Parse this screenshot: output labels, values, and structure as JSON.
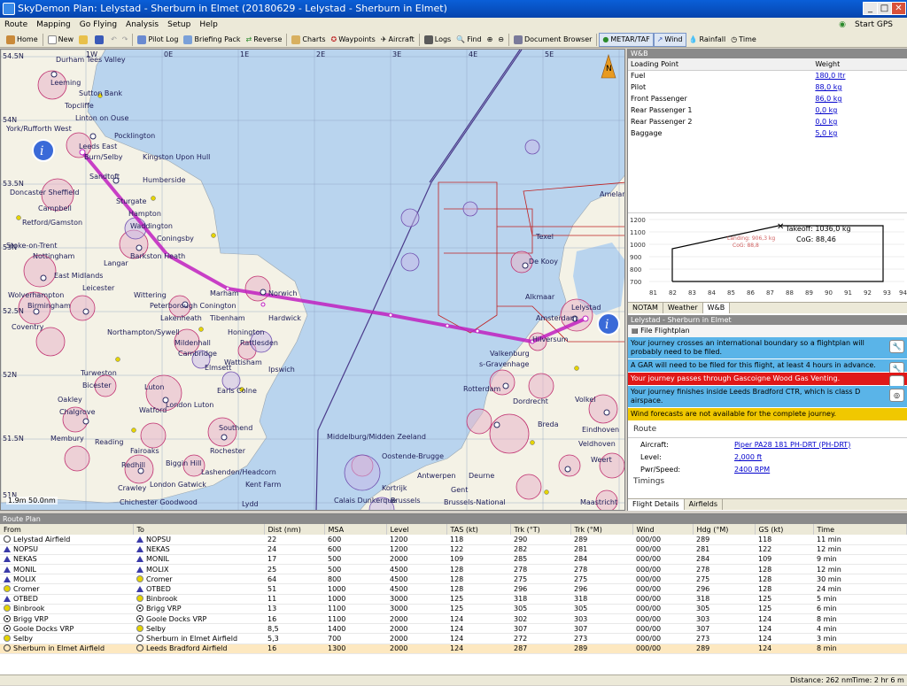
{
  "window": {
    "title": "SkyDemon Plan: Lelystad - Sherburn in Elmet (20180629 - Lelystad - Sherburn in Elmet)",
    "min": "_",
    "max": "□",
    "close": "✕"
  },
  "menu": {
    "items": [
      "Route",
      "Mapping",
      "Go Flying",
      "Analysis",
      "Setup",
      "Help"
    ],
    "start_gps": "Start GPS"
  },
  "toolbar": {
    "home": "Home",
    "new": "New",
    "pilot_log": "Pilot Log",
    "briefing": "Briefing Pack",
    "reverse": "Reverse",
    "charts": "Charts",
    "waypoints": "Waypoints",
    "aircraft": "Aircraft",
    "logs": "Logs",
    "find": "Find",
    "doc_browser": "Document Browser",
    "metar": "METAR/TAF",
    "wind": "Wind",
    "rainfall": "Rainfall",
    "time": "Time"
  },
  "map": {
    "lon_labels": [
      "1W",
      "0E",
      "1E",
      "2E",
      "3E",
      "4E",
      "5E"
    ],
    "lat_labels": [
      "54.5N",
      "54N",
      "53.5N",
      "53N",
      "52.5N",
      "52N",
      "51.5N",
      "51N"
    ],
    "north": "N",
    "places": [
      "Durham Tees Valley",
      "Leeming",
      "Sutton Bank",
      "Topcliffe",
      "Linton on Ouse",
      "York/Rufforth West",
      "Pocklington",
      "Leeds East",
      "Burn/Selby",
      "Kingston Upon Hull",
      "Humberside",
      "Sandtoft",
      "Doncaster Sheffield",
      "Sturgate",
      "Campbell",
      "Retford/Gamston",
      "Hampton",
      "Waddington",
      "Coningsby",
      "Barkston Heath",
      "Stoke-on-Trent",
      "Nottingham",
      "Langar",
      "East Midlands",
      "Leicester",
      "Marham",
      "Norwich",
      "Wolverhampton",
      "Birmingham",
      "Wittering",
      "Peterborough Conington",
      "Lakenheath",
      "Tibenham",
      "Hardwick",
      "Coventry",
      "Northampton/Sywell",
      "Honington",
      "Mildenhall",
      "Rattlesden",
      "Wattisham",
      "Ipswich",
      "Cambridge",
      "Elmsett",
      "Earls Colne",
      "Turweston",
      "Bicester",
      "Oakley",
      "Luton",
      "London Luton",
      "Chalgrove",
      "Watford",
      "Southend",
      "Membury",
      "Reading",
      "Fairoaks",
      "Biggin Hill",
      "Rochester",
      "Redhill",
      "London Gatwick",
      "Lashenden/Headcorn",
      "Kent Farm",
      "Lydd",
      "Crawley",
      "Chichester Goodwood",
      "Texel",
      "De Kooy",
      "Alkmaar",
      "Amsterdam",
      "Lelystad",
      "Hilversum",
      "Valkenburg",
      "s-Gravenhage",
      "Rotterdam",
      "Dordrecht",
      "Eindhoven",
      "Breda",
      "Middelburg/Midden Zeeland",
      "Oostende-Brugge",
      "Antwerpen",
      "Deurne",
      "Kortrijk",
      "Gent",
      "Calais Dunkerque",
      "Brussels",
      "Brussels-National",
      "Maastricht",
      "Volkel",
      "Veldhoven",
      "Weert",
      "Ameland"
    ],
    "scale": "1.9m 50.0nm"
  },
  "wb": {
    "header": "W&B",
    "col_item": "Loading Point",
    "col_weight": "Weight",
    "rows": [
      {
        "item": "Fuel",
        "weight": "180,0 ltr"
      },
      {
        "item": "Pilot",
        "weight": "88,0 kg"
      },
      {
        "item": "Front Passenger",
        "weight": "86,0 kg"
      },
      {
        "item": "Rear Passenger 1",
        "weight": "0,0 kg"
      },
      {
        "item": "Rear Passenger 2",
        "weight": "0,0 kg"
      },
      {
        "item": "Baggage",
        "weight": "5,0 kg"
      }
    ],
    "cog_chart": {
      "y_ticks": [
        "1200",
        "1100",
        "1000",
        "900",
        "800",
        "700"
      ],
      "x_ticks": [
        "81",
        "82",
        "83",
        "84",
        "85",
        "86",
        "87",
        "88",
        "89",
        "90",
        "91",
        "92",
        "93",
        "94"
      ],
      "takeoff": "Takeoff: 1036,0 kg",
      "cog": "CoG: 88,46",
      "landing": "Landing: 906,3 kg",
      "landing_cog": "CoG: 88,8"
    },
    "tabs": [
      "NOTAM",
      "Weather",
      "W&B"
    ]
  },
  "flight": {
    "header": "Lelystad - Sherburn in Elmet",
    "file_label": "File Flightplan",
    "messages": [
      {
        "text": "Your journey crosses an international boundary so a flightplan will probably need to be filed.",
        "color": "#5ab4e8",
        "icon": "wrench"
      },
      {
        "text": "A GAR will need to be filed for this flight, at least 4 hours in advance.",
        "color": "#5ab4e8",
        "icon": "wrench"
      },
      {
        "text": "Your journey passes through Gascoigne Wood Gas Venting.",
        "color": "#e01818",
        "icon": "binoculars"
      },
      {
        "text": "Your journey finishes inside Leeds Bradford CTR, which is class D airspace.",
        "color": "#5ab4e8",
        "icon": "binoculars"
      },
      {
        "text": "Wind forecasts are not available for the complete journey.",
        "color": "#f0c800",
        "icon": ""
      }
    ],
    "route_title": "Route",
    "aircraft_label": "Aircraft:",
    "aircraft_value": "Piper PA28 181 PH-DRT (PH-DRT)",
    "level_label": "Level:",
    "level_value": "2,000 ft",
    "pwr_label": "Pwr/Speed:",
    "pwr_value": "2400 RPM",
    "timings": "Timings",
    "tabs": [
      "Flight Details",
      "Airfields"
    ]
  },
  "route_plan": {
    "title": "Route Plan",
    "columns": [
      "From",
      "To",
      "Dist (nm)",
      "MSA",
      "Level",
      "TAS (kt)",
      "Trk (°T)",
      "Trk (°M)",
      "Wind",
      "Hdg (°M)",
      "GS (kt)",
      "Time"
    ],
    "rows": [
      {
        "from": "Lelystad Airfield",
        "from_icon": "air",
        "to": "NOPSU",
        "to_icon": "tri",
        "dist": "22",
        "msa": "600",
        "level": "1200",
        "tas": "118",
        "trkt": "290",
        "trkm": "289",
        "wind": "000/00",
        "hdg": "289",
        "gs": "118",
        "time": "11 min"
      },
      {
        "from": "NOPSU",
        "from_icon": "tri",
        "to": "NEKAS",
        "to_icon": "tri",
        "dist": "24",
        "msa": "600",
        "level": "1200",
        "tas": "122",
        "trkt": "282",
        "trkm": "281",
        "wind": "000/00",
        "hdg": "281",
        "gs": "122",
        "time": "12 min"
      },
      {
        "from": "NEKAS",
        "from_icon": "tri",
        "to": "MONIL",
        "to_icon": "tri",
        "dist": "17",
        "msa": "500",
        "level": "2000",
        "tas": "109",
        "trkt": "285",
        "trkm": "284",
        "wind": "000/00",
        "hdg": "284",
        "gs": "109",
        "time": "9 min"
      },
      {
        "from": "MONIL",
        "from_icon": "tri",
        "to": "MOLIX",
        "to_icon": "tri",
        "dist": "25",
        "msa": "500",
        "level": "4500",
        "tas": "128",
        "trkt": "278",
        "trkm": "278",
        "wind": "000/00",
        "hdg": "278",
        "gs": "128",
        "time": "12 min"
      },
      {
        "from": "MOLIX",
        "from_icon": "tri",
        "to": "Cromer",
        "to_icon": "dot",
        "dist": "64",
        "msa": "800",
        "level": "4500",
        "tas": "128",
        "trkt": "275",
        "trkm": "275",
        "wind": "000/00",
        "hdg": "275",
        "gs": "128",
        "time": "30 min"
      },
      {
        "from": "Cromer",
        "from_icon": "dot",
        "to": "OTBED",
        "to_icon": "tri",
        "dist": "51",
        "msa": "1000",
        "level": "4500",
        "tas": "128",
        "trkt": "296",
        "trkm": "296",
        "wind": "000/00",
        "hdg": "296",
        "gs": "128",
        "time": "24 min"
      },
      {
        "from": "OTBED",
        "from_icon": "tri",
        "to": "Binbrook",
        "to_icon": "dot",
        "dist": "11",
        "msa": "1000",
        "level": "3000",
        "tas": "125",
        "trkt": "318",
        "trkm": "318",
        "wind": "000/00",
        "hdg": "318",
        "gs": "125",
        "time": "5 min"
      },
      {
        "from": "Binbrook",
        "from_icon": "dot",
        "to": "Brigg VRP",
        "to_icon": "vrp",
        "dist": "13",
        "msa": "1100",
        "level": "3000",
        "tas": "125",
        "trkt": "305",
        "trkm": "305",
        "wind": "000/00",
        "hdg": "305",
        "gs": "125",
        "time": "6 min"
      },
      {
        "from": "Brigg VRP",
        "from_icon": "vrp",
        "to": "Goole Docks VRP",
        "to_icon": "vrp",
        "dist": "16",
        "msa": "1100",
        "level": "2000",
        "tas": "124",
        "trkt": "302",
        "trkm": "303",
        "wind": "000/00",
        "hdg": "303",
        "gs": "124",
        "time": "8 min"
      },
      {
        "from": "Goole Docks VRP",
        "from_icon": "vrp",
        "to": "Selby",
        "to_icon": "dot",
        "dist": "8,5",
        "msa": "1400",
        "level": "2000",
        "tas": "124",
        "trkt": "307",
        "trkm": "307",
        "wind": "000/00",
        "hdg": "307",
        "gs": "124",
        "time": "4 min"
      },
      {
        "from": "Selby",
        "from_icon": "dot",
        "to": "Sherburn in Elmet Airfield",
        "to_icon": "air",
        "dist": "5,3",
        "msa": "700",
        "level": "2000",
        "tas": "124",
        "trkt": "272",
        "trkm": "273",
        "wind": "000/00",
        "hdg": "273",
        "gs": "124",
        "time": "3 min"
      },
      {
        "from": "Sherburn in Elmet Airfield",
        "from_icon": "air",
        "to": "Leeds Bradford Airfield",
        "to_icon": "air",
        "dist": "16",
        "msa": "1300",
        "level": "2000",
        "tas": "124",
        "trkt": "287",
        "trkm": "289",
        "wind": "000/00",
        "hdg": "289",
        "gs": "124",
        "time": "8 min"
      }
    ]
  },
  "status": {
    "distance": "Distance: 262 nm",
    "time": "Time: 2 hr 6 m"
  }
}
